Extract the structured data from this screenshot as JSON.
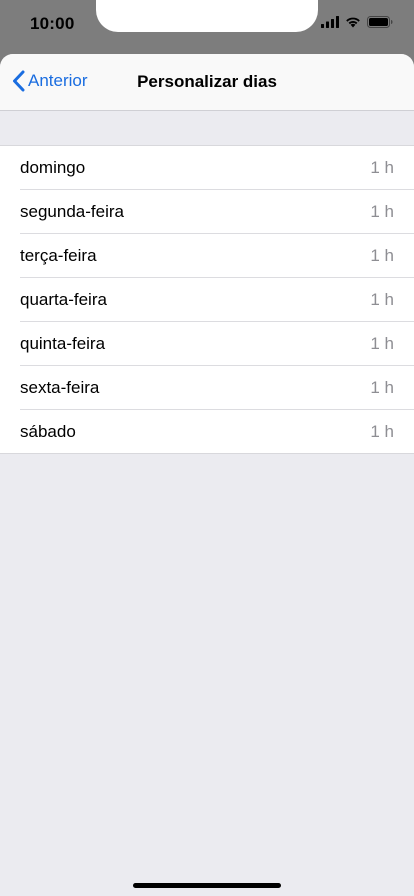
{
  "status_bar": {
    "time": "10:00",
    "icons": [
      "cellular-signal-icon",
      "wifi-icon",
      "battery-icon"
    ]
  },
  "nav": {
    "back_label": "Anterior",
    "back_icon": "chevron-left-icon",
    "title": "Personalizar dias"
  },
  "days": [
    {
      "label": "domingo",
      "value": "1 h"
    },
    {
      "label": "segunda-feira",
      "value": "1 h"
    },
    {
      "label": "terça-feira",
      "value": "1 h"
    },
    {
      "label": "quarta-feira",
      "value": "1 h"
    },
    {
      "label": "quinta-feira",
      "value": "1 h"
    },
    {
      "label": "sexta-feira",
      "value": "1 h"
    },
    {
      "label": "sábado",
      "value": "1 h"
    }
  ],
  "colors": {
    "accent": "#1a6de0",
    "background": "#ebebf0",
    "secondary_text": "#8e8e93"
  }
}
